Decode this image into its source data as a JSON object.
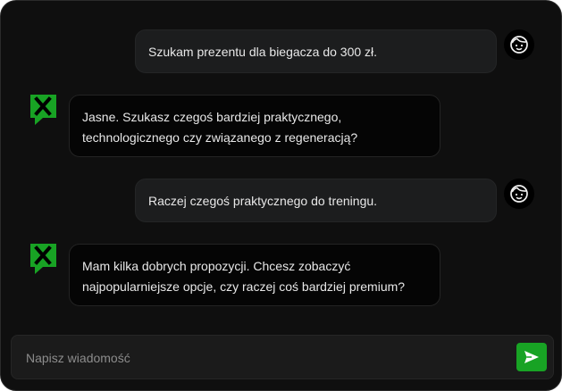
{
  "colors": {
    "accent": "#18a324",
    "background": "#0f0f0f",
    "user_bubble": "#1c1d1e",
    "bot_bubble": "#050505"
  },
  "messages": [
    {
      "role": "user",
      "text": "Szukam prezentu dla biegacza do 300 zł.",
      "avatar_icon": "face-icon"
    },
    {
      "role": "assistant",
      "text": "Jasne. Szukasz czegoś bardziej praktycznego, technologicznego czy związanego z regeneracją?",
      "avatar_icon": "brand-logo-icon"
    },
    {
      "role": "user",
      "text": "Raczej czegoś praktycznego do treningu.",
      "avatar_icon": "face-icon"
    },
    {
      "role": "assistant",
      "text": "Mam kilka dobrych propozycji. Chcesz zobaczyć najpopularniejsze opcje, czy raczej coś bardziej premium?",
      "avatar_icon": "brand-logo-icon"
    }
  ],
  "composer": {
    "placeholder": "Napisz wiadomość",
    "value": "",
    "send_icon": "send-icon"
  }
}
